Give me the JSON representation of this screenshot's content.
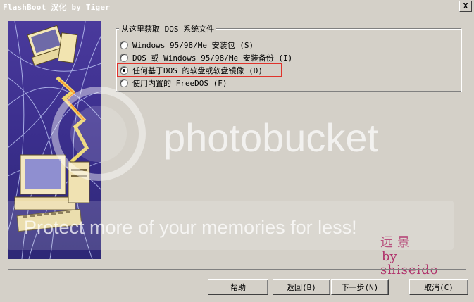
{
  "window": {
    "title": "FlashBoot 汉化 by Tiger",
    "close_label": "X"
  },
  "group": {
    "legend": "从这里获取 DOS 系统文件",
    "options": [
      {
        "label": "Windows 95/98/Me 安装包 (S)",
        "selected": false
      },
      {
        "label": "DOS 或 Windows 95/98/Me 安装备份 (I)",
        "selected": false
      },
      {
        "label": "任何基于DOS 的软盘或软盘镜像 (D)",
        "selected": true
      },
      {
        "label": "使用内置的 FreeDOS (F)",
        "selected": false
      }
    ]
  },
  "buttons": {
    "help": "帮助",
    "back": "返回(B)",
    "next": "下一步(N)",
    "cancel": "取消(C)"
  },
  "watermark": {
    "brand": "photobucket",
    "tagline": "Protect more of your memories for less!"
  },
  "signature": {
    "line1": "远景",
    "line2": "by",
    "line3": "shiseido"
  },
  "colors": {
    "highlight_box": "#e0332b",
    "signature": "#b0306a",
    "art_background": "#3b2d8e"
  }
}
